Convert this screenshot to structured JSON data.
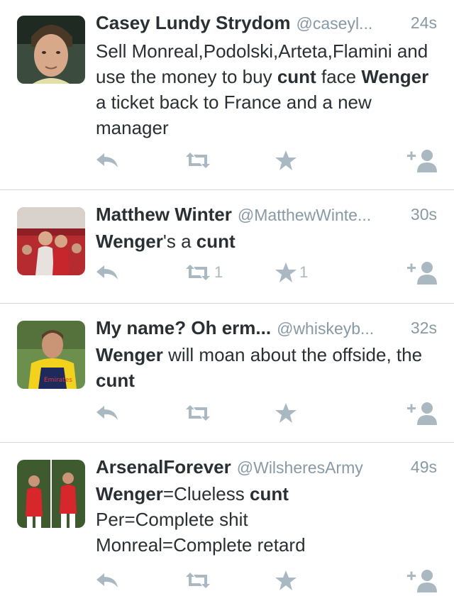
{
  "tweets": [
    {
      "name": "Casey Lundy Strydom",
      "handle": "@caseyl...",
      "time": "24s",
      "text": [
        {
          "t": "Sell Monreal,Podolski,Arteta,Flamini and use the money to buy ",
          "b": false
        },
        {
          "t": "cunt",
          "b": true
        },
        {
          "t": " face ",
          "b": false
        },
        {
          "t": "Wenger",
          "b": true
        },
        {
          "t": " a ticket back to France and a new manager",
          "b": false
        }
      ],
      "retweets": "",
      "favorites": ""
    },
    {
      "name": "Matthew Winter",
      "handle": "@MatthewWinte...",
      "time": "30s",
      "text": [
        {
          "t": "Wenger",
          "b": true
        },
        {
          "t": "'s a ",
          "b": false
        },
        {
          "t": "cunt",
          "b": true
        }
      ],
      "retweets": "1",
      "favorites": "1"
    },
    {
      "name": "My name? Oh erm...",
      "handle": "@whiskeyb...",
      "time": "32s",
      "text": [
        {
          "t": "Wenger",
          "b": true
        },
        {
          "t": " will moan about the offside, the ",
          "b": false
        },
        {
          "t": "cunt",
          "b": true
        }
      ],
      "retweets": "",
      "favorites": ""
    },
    {
      "name": "ArsenalForever",
      "handle": "@WilsheresArmy",
      "time": "49s",
      "text": [
        {
          "t": "Wenger",
          "b": true
        },
        {
          "t": "=Clueless ",
          "b": false
        },
        {
          "t": "cunt",
          "b": true
        },
        {
          "t": "\nPer=Complete shit\nMonreal=Complete retard",
          "b": false
        }
      ],
      "retweets": "",
      "favorites": ""
    }
  ],
  "icons": {
    "reply": "reply-icon",
    "retweet": "retweet-icon",
    "favorite": "star-icon",
    "follow": "follow-icon"
  },
  "colors": {
    "text": "#292f33",
    "muted": "#8899a6",
    "icon": "#aab8c2",
    "divider": "#d6d9dc"
  }
}
